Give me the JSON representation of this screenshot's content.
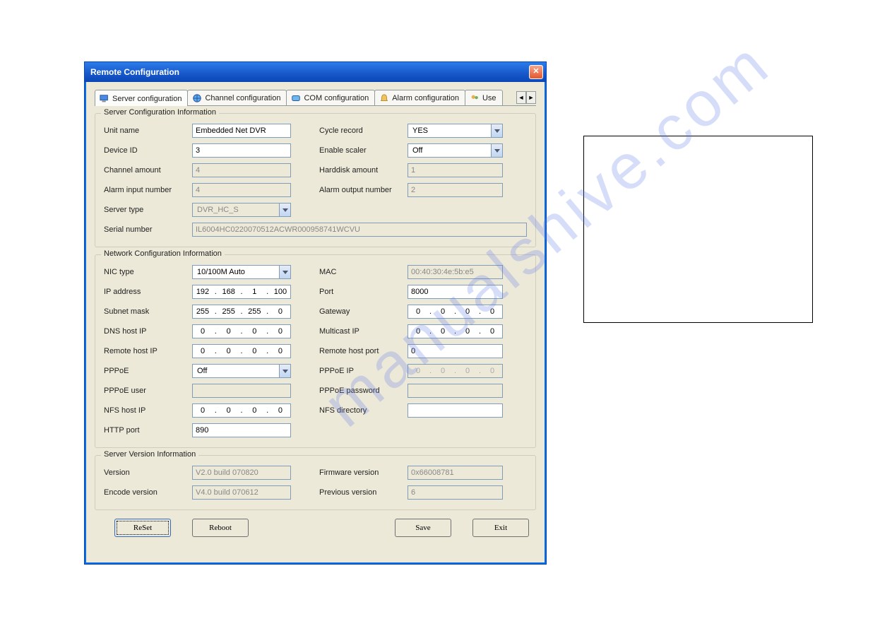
{
  "window": {
    "title": "Remote Configuration"
  },
  "tabs": {
    "t0": "Server configuration",
    "t1": "Channel configuration",
    "t2": "COM configuration",
    "t3": "Alarm configuration",
    "t4": "Use"
  },
  "server": {
    "legend": "Server Configuration Information",
    "unit_name_label": "Unit name",
    "unit_name": "Embedded Net DVR",
    "cycle_record_label": "Cycle record",
    "cycle_record": "YES",
    "device_id_label": "Device ID",
    "device_id": "3",
    "enable_scaler_label": "Enable scaler",
    "enable_scaler": "Off",
    "channel_amount_label": "Channel amount",
    "channel_amount": "4",
    "harddisk_amount_label": "Harddisk amount",
    "harddisk_amount": "1",
    "alarm_in_label": "Alarm input number",
    "alarm_in": "4",
    "alarm_out_label": "Alarm output number",
    "alarm_out": "2",
    "server_type_label": "Server type",
    "server_type": "DVR_HC_S",
    "serial_label": "Serial number",
    "serial": "IL6004HC0220070512ACWR000958741WCVU"
  },
  "network": {
    "legend": "Network Configuration Information",
    "nic_type_label": "NIC type",
    "nic_type": "10/100M Auto",
    "mac_label": "MAC",
    "mac": "00:40:30:4e:5b:e5",
    "ip_label": "IP address",
    "ip": {
      "o1": "192",
      "o2": "168",
      "o3": "1",
      "o4": "100"
    },
    "port_label": "Port",
    "port": "8000",
    "mask_label": "Subnet mask",
    "mask": {
      "o1": "255",
      "o2": "255",
      "o3": "255",
      "o4": "0"
    },
    "gw_label": "Gateway",
    "gw": {
      "o1": "0",
      "o2": "0",
      "o3": "0",
      "o4": "0"
    },
    "dns_label": "DNS host IP",
    "dns": {
      "o1": "0",
      "o2": "0",
      "o3": "0",
      "o4": "0"
    },
    "mcast_label": "Multicast IP",
    "mcast": {
      "o1": "0",
      "o2": "0",
      "o3": "0",
      "o4": "0"
    },
    "rhost_label": "Remote host IP",
    "rhost": {
      "o1": "0",
      "o2": "0",
      "o3": "0",
      "o4": "0"
    },
    "rport_label": "Remote host port",
    "rport": "0",
    "pppoe_label": "PPPoE",
    "pppoe": "Off",
    "pppoe_ip_label": "PPPoE IP",
    "pppoe_ip": {
      "o1": "0",
      "o2": "0",
      "o3": "0",
      "o4": "0"
    },
    "pppoe_user_label": "PPPoE user",
    "pppoe_user": "",
    "pppoe_pass_label": "PPPoE password",
    "pppoe_pass": "",
    "nfs_host_label": "NFS host IP",
    "nfs_host": {
      "o1": "0",
      "o2": "0",
      "o3": "0",
      "o4": "0"
    },
    "nfs_dir_label": "NFS directory",
    "nfs_dir": "",
    "http_port_label": "HTTP port",
    "http_port": "890"
  },
  "version": {
    "legend": "Server Version Information",
    "version_label": "Version",
    "version": "V2.0 build 070820",
    "firmware_label": "Firmware version",
    "firmware": "0x66008781",
    "encode_label": "Encode version",
    "encode": "V4.0 build 070612",
    "previous_label": "Previous version",
    "previous": "6"
  },
  "buttons": {
    "reset": "ReSet",
    "reboot": "Reboot",
    "save": "Save",
    "exit": "Exit"
  },
  "watermark": "manualshive.com"
}
